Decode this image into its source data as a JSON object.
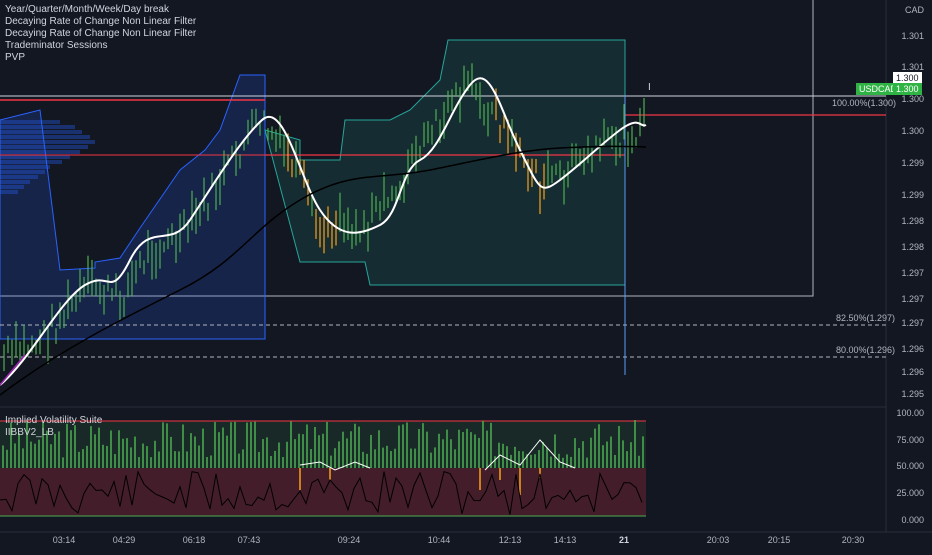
{
  "legend": {
    "items": [
      "Year/Quarter/Month/Week/Day break",
      "Decaying Rate of Change Non Linear Filter",
      "Decaying Rate of Change Non Linear Filter",
      "Trademinator Sessions",
      "PVP"
    ]
  },
  "currency": "CAD",
  "price_axis": [
    "1.301",
    "1.301",
    "1.300",
    "1.300",
    "1.299",
    "1.299",
    "1.298",
    "1.298",
    "1.297",
    "1.297",
    "1.297",
    "1.296",
    "1.296",
    "1.295"
  ],
  "price_tag_top": "1.300",
  "symbol_tag": {
    "symbol": "USDCAD",
    "price": "1.300"
  },
  "fib_levels": [
    {
      "label": "100.00%(1.300)"
    },
    {
      "label": "82.50%(1.297)"
    },
    {
      "label": "80.00%(1.296)"
    }
  ],
  "indicator": {
    "title": "Implied Volatility Suite",
    "subtitle": "IIBBV2_LB",
    "axis": [
      "100.00",
      "75.000",
      "50.000",
      "25.000",
      "0.000"
    ]
  },
  "time_axis": [
    {
      "label": "03:14",
      "bold": false
    },
    {
      "label": "04:29",
      "bold": false
    },
    {
      "label": "06:18",
      "bold": false
    },
    {
      "label": "07:43",
      "bold": false
    },
    {
      "label": "09:24",
      "bold": false
    },
    {
      "label": "10:44",
      "bold": false
    },
    {
      "label": "12:13",
      "bold": false
    },
    {
      "label": "14:13",
      "bold": false
    },
    {
      "label": "21",
      "bold": true
    },
    {
      "label": "20:03",
      "bold": false
    },
    {
      "label": "20:15",
      "bold": false
    },
    {
      "label": "20:30",
      "bold": false
    }
  ],
  "colors": {
    "background": "#131722",
    "bull": "#26a69a",
    "up_wick": "#4caf50",
    "down": "#f7a21b",
    "red_line": "#f23645",
    "accent_green": "#2fb344"
  }
}
